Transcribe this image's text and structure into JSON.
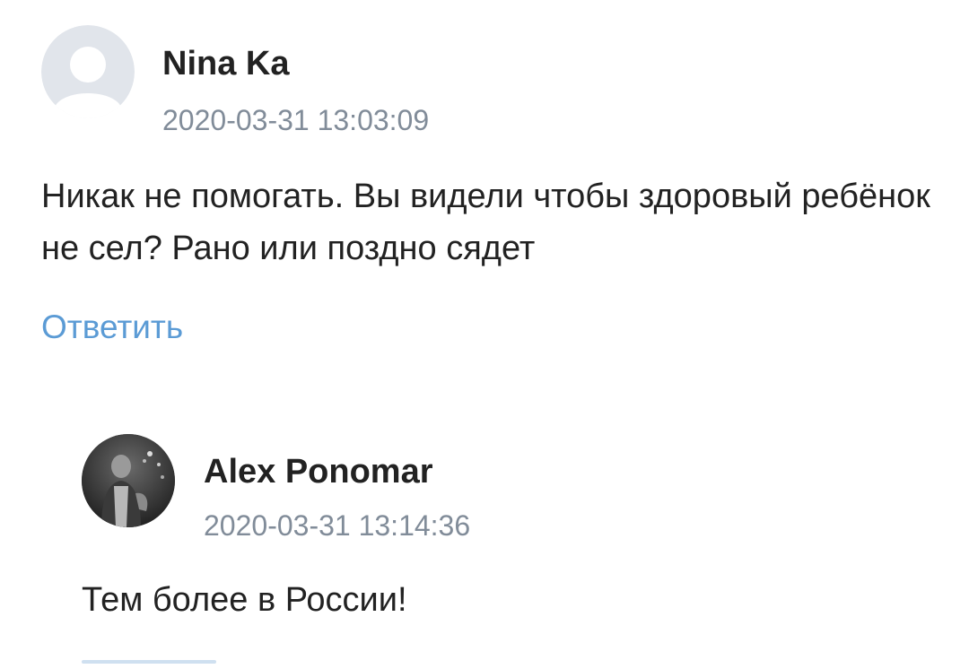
{
  "comments": [
    {
      "author": "Nina Ka",
      "timestamp": "2020-03-31 13:03:09",
      "text": "Никак не помогать. Вы видели чтобы здоровый ребёнок не сел? Рано или поздно сядет",
      "reply_label": "Ответить",
      "avatar_icon": "default-user-avatar-icon"
    },
    {
      "author": "Alex Ponomar",
      "timestamp": "2020-03-31 13:14:36",
      "text": "Тем более в России!",
      "avatar_icon": "user-photo-avatar"
    }
  ],
  "colors": {
    "text": "#222222",
    "meta": "#818c99",
    "link": "#5b9bd5",
    "avatar_bg": "#e1e5eb",
    "avatar_silhouette": "#ffffff"
  }
}
